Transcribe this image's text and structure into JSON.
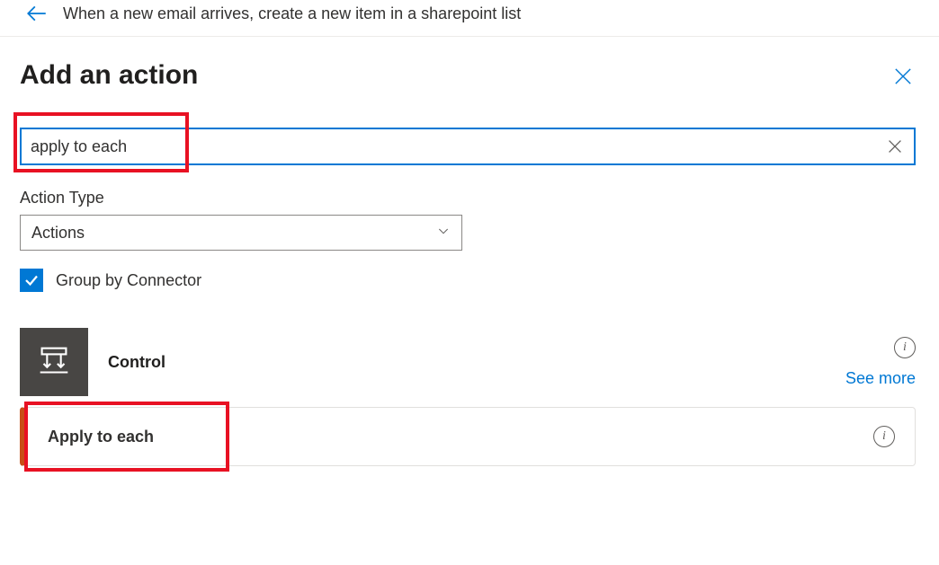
{
  "header": {
    "flow_title": "When a new email arrives, create a new item in a sharepoint list"
  },
  "panel": {
    "title": "Add an action",
    "search_value": "apply to each",
    "action_type_label": "Action Type",
    "action_type_value": "Actions",
    "group_by_label": "Group by Connector",
    "group_by_checked": true
  },
  "connector": {
    "name": "Control",
    "see_more": "See more"
  },
  "actions": [
    {
      "name": "Apply to each"
    }
  ],
  "colors": {
    "accent": "#0078D4",
    "highlight": "#E81123",
    "control_bg": "#484644",
    "action_accent": "#C84E17"
  }
}
